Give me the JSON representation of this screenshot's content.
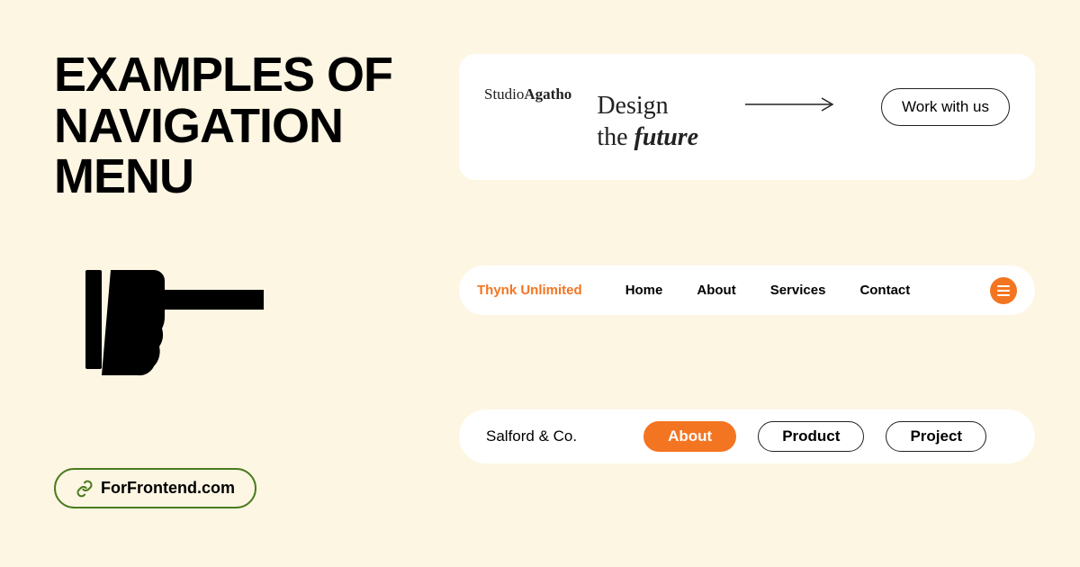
{
  "title": "EXAMPLES OF NAVIGATION MENU",
  "site_link": "ForFrontend.com",
  "example1": {
    "logo_prefix": "Studio",
    "logo_suffix": "Agatho",
    "tagline_line1": "Design",
    "tagline_line2_prefix": "the ",
    "tagline_line2_italic": "future",
    "cta": "Work with us"
  },
  "example2": {
    "logo": "Thynk Unlimited",
    "items": [
      "Home",
      "About",
      "Services",
      "Contact"
    ]
  },
  "example3": {
    "logo": "Salford & Co.",
    "items": [
      "About",
      "Product",
      "Project"
    ],
    "active_index": 0
  }
}
